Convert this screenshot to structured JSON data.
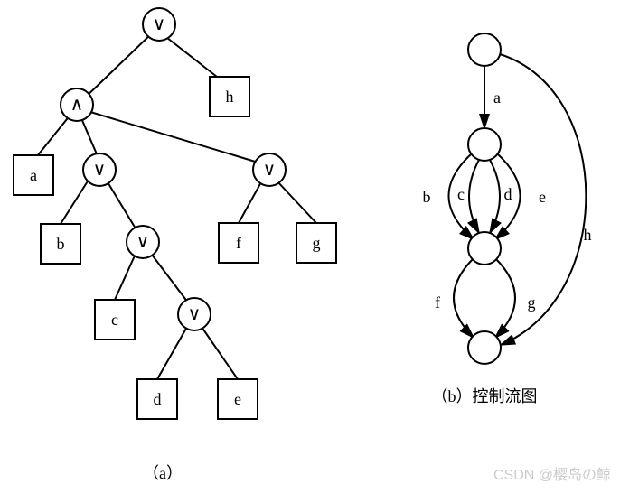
{
  "tree": {
    "ops": {
      "root": "∨",
      "and": "∧",
      "or_mid": "∨",
      "or_right": "∨",
      "or_bc": "∨",
      "or_de": "∨"
    },
    "leaves": {
      "h": "h",
      "a": "a",
      "b": "b",
      "f": "f",
      "g": "g",
      "c": "c",
      "d": "d",
      "e": "e"
    },
    "caption": "（a）"
  },
  "flow": {
    "edge_labels": {
      "a": "a",
      "b": "b",
      "c": "c",
      "d": "d",
      "e": "e",
      "f": "f",
      "g": "g",
      "h": "h"
    },
    "caption": "（b）控制流图"
  },
  "watermark": "CSDN @樱岛の鲸"
}
